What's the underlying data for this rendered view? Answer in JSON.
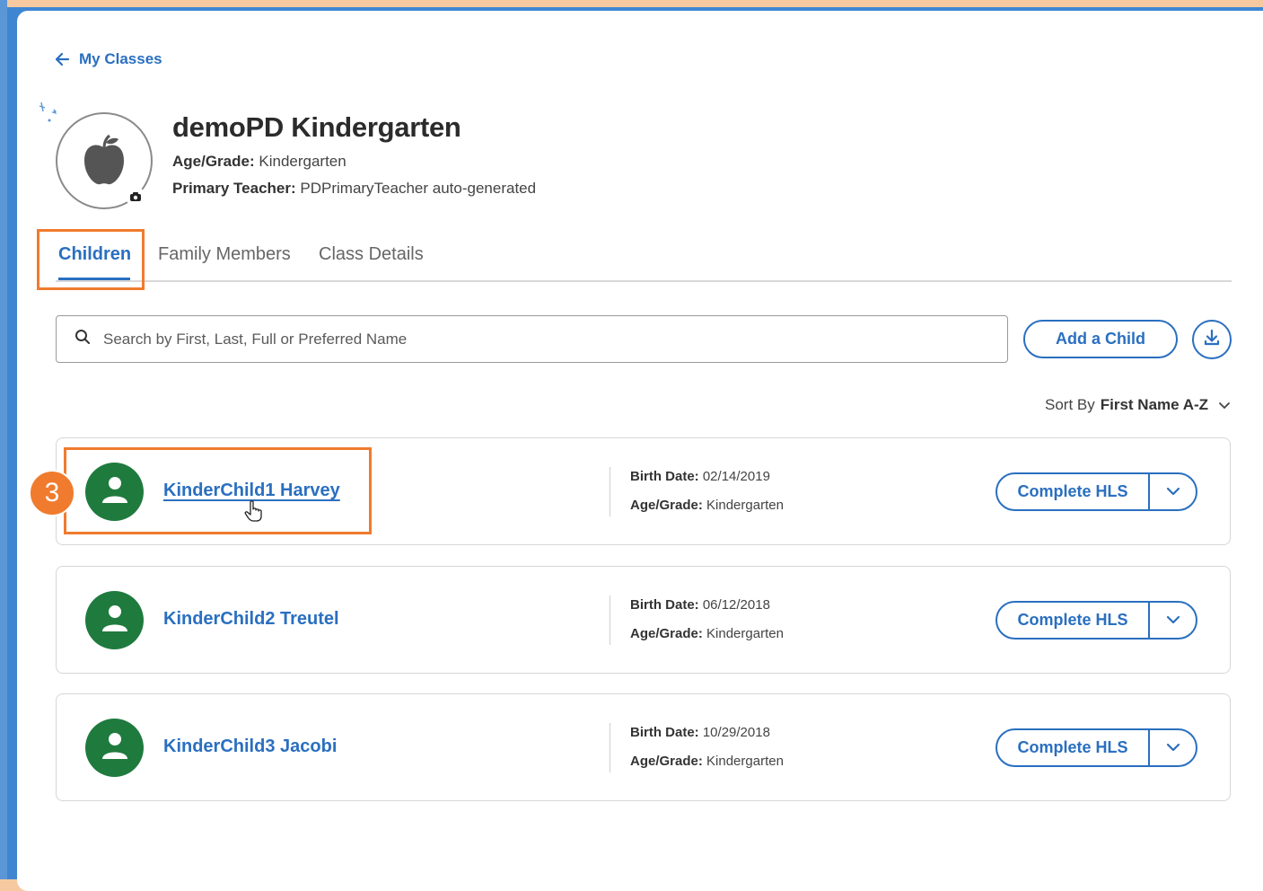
{
  "nav": {
    "back_label": "My Classes"
  },
  "class": {
    "title": "demoPD Kindergarten",
    "age_grade_label": "Age/Grade:",
    "age_grade_value": "Kindergarten",
    "teacher_label": "Primary Teacher:",
    "teacher_value": "PDPrimaryTeacher auto-generated"
  },
  "tabs": [
    {
      "label": "Children",
      "active": true
    },
    {
      "label": "Family Members",
      "active": false
    },
    {
      "label": "Class Details",
      "active": false
    }
  ],
  "search": {
    "placeholder": "Search by First, Last, Full or Preferred Name"
  },
  "actions": {
    "add_child_label": "Add a Child"
  },
  "sort": {
    "label": "Sort By",
    "value": "First Name A-Z"
  },
  "children": [
    {
      "name": "KinderChild1 Harvey",
      "birth_label": "Birth Date:",
      "birth_date": "02/14/2019",
      "grade_label": "Age/Grade:",
      "grade": "Kindergarten",
      "action": "Complete HLS"
    },
    {
      "name": "KinderChild2 Treutel",
      "birth_label": "Birth Date:",
      "birth_date": "06/12/2018",
      "grade_label": "Age/Grade:",
      "grade": "Kindergarten",
      "action": "Complete HLS"
    },
    {
      "name": "KinderChild3 Jacobi",
      "birth_label": "Birth Date:",
      "birth_date": "10/29/2018",
      "grade_label": "Age/Grade:",
      "grade": "Kindergarten",
      "action": "Complete HLS"
    }
  ],
  "annotation": {
    "step_number": "3"
  },
  "colors": {
    "primary": "#2a6fc0",
    "avatar_green": "#1f7a3e",
    "highlight_orange": "#f07b2e"
  },
  "icons": [
    "arrow-left-icon",
    "apple-icon",
    "camera-icon",
    "search-icon",
    "download-icon",
    "chevron-down-icon",
    "person-icon",
    "hand-cursor-icon"
  ]
}
